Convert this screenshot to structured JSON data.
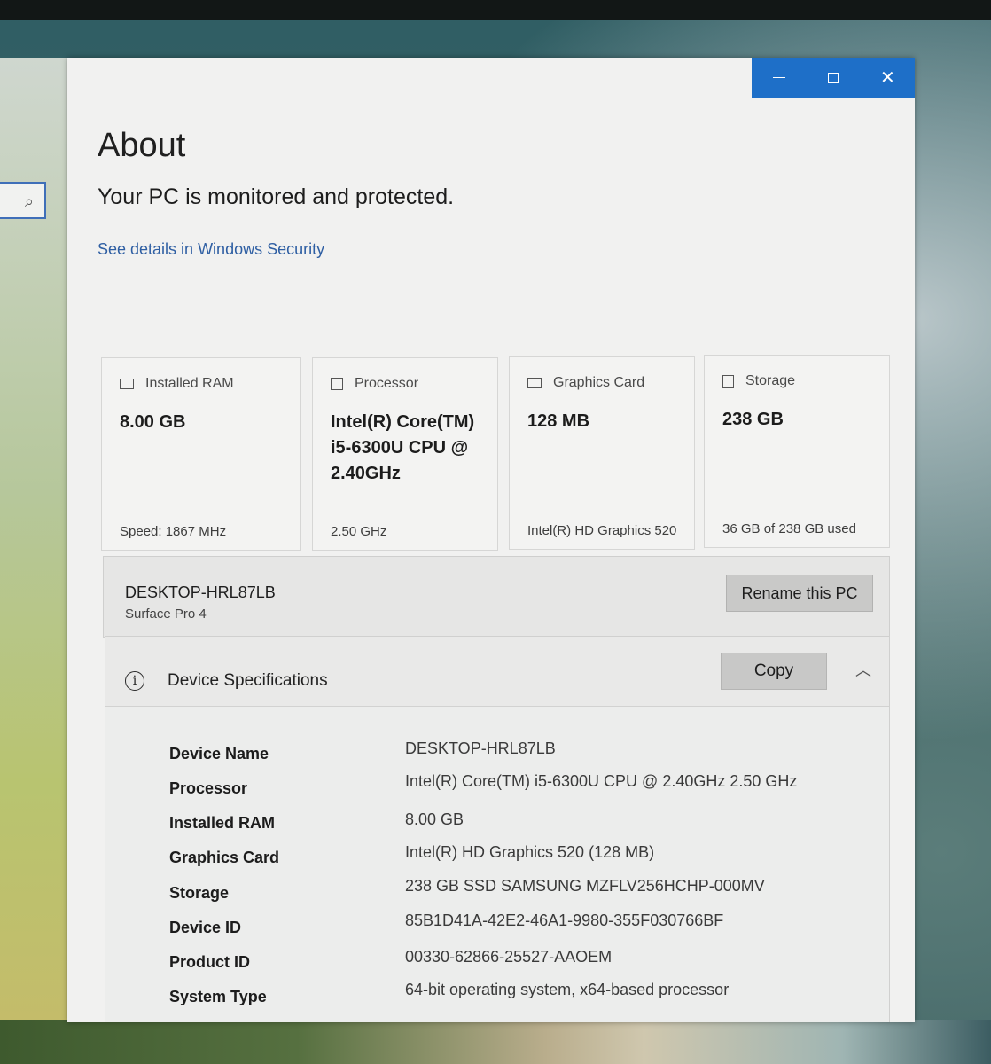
{
  "window": {
    "controls": {
      "minimize": "minimize-icon",
      "maximize": "maximize-icon",
      "close": "close-icon"
    },
    "close_glyph": "✕"
  },
  "search_icon": "⌕",
  "page_title": "About",
  "protection_message": "Your PC is monitored and protected.",
  "security_link": "See details in Windows Security",
  "cards": [
    {
      "label": "Installed RAM",
      "value": "8.00 GB",
      "footer": "Speed: 1867 MHz",
      "icon": "ram-icon"
    },
    {
      "label": "Processor",
      "value": "Intel(R) Core(TM) i5-6300U CPU @ 2.40GHz",
      "footer": "2.50 GHz",
      "icon": "processor-icon"
    },
    {
      "label": "Graphics Card",
      "value": "128 MB",
      "footer": "Intel(R) HD Graphics 520",
      "icon": "graphics-card-icon"
    },
    {
      "label": "Storage",
      "value": "238 GB",
      "footer": "36 GB of 238 GB used",
      "icon": "storage-icon"
    }
  ],
  "pc": {
    "name": "DESKTOP-HRL87LB",
    "model": "Surface Pro 4",
    "rename_label": "Rename this PC"
  },
  "specs": {
    "title": "Device Specifications",
    "copy_label": "Copy",
    "info_glyph": "i",
    "chevron_glyph": "︿",
    "rows": [
      {
        "key": "Device Name",
        "value": "DESKTOP-HRL87LB"
      },
      {
        "key": "Processor",
        "value": "Intel(R) Core(TM) i5-6300U CPU @ 2.40GHz   2.50 GHz"
      },
      {
        "key": "Installed RAM",
        "value": "8.00 GB"
      },
      {
        "key": "Graphics Card",
        "value": "Intel(R) HD Graphics 520 (128 MB)"
      },
      {
        "key": "Storage",
        "value": "238 GB SSD SAMSUNG MZFLV256HCHP-000MV"
      },
      {
        "key": "Device ID",
        "value": "85B1D41A-42E2-46A1-9980-355F030766BF"
      },
      {
        "key": "Product ID",
        "value": "00330-62866-25527-AAOEM"
      },
      {
        "key": "System Type",
        "value": "64-bit operating system, x64-based processor"
      }
    ]
  },
  "colors": {
    "accent": "#1e6fc8",
    "link": "#2f5fa3"
  }
}
